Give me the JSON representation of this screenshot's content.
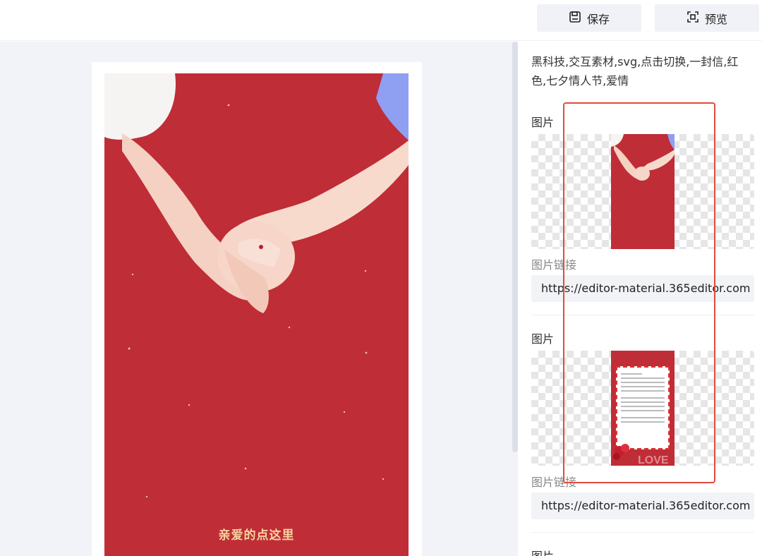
{
  "toolbar": {
    "save_label": "保存",
    "preview_label": "预览"
  },
  "poster": {
    "cta_text": "亲爱的点这里"
  },
  "panel": {
    "tags": "黑科技,交互素材,svg,点击切换,一封信,红色,七夕情人节,爱情",
    "images": [
      {
        "label": "图片",
        "link_label": "图片链接",
        "url": "https://editor-material.365editor.com"
      },
      {
        "label": "图片",
        "link_label": "图片链接",
        "url": "https://editor-material.365editor.com"
      },
      {
        "label": "图片"
      }
    ]
  },
  "colors": {
    "poster_red": "#bf2d37",
    "cta_gold": "#f6d49e",
    "highlight_red": "#e04b3c",
    "button_bg": "#f0f2f7"
  },
  "icons": {
    "save": "save-icon",
    "preview": "preview-icon"
  }
}
